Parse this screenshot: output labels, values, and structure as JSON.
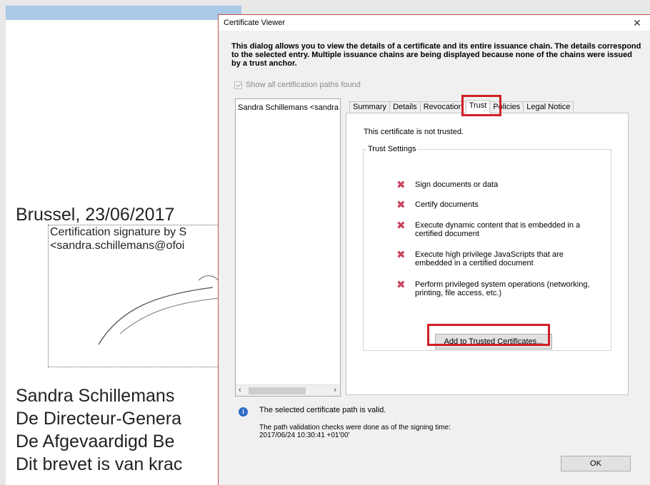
{
  "document": {
    "heading": "Brussel, 23/06/2017",
    "sig_line1": "Certification signature by S",
    "sig_line2": "<sandra.schillemans@ofoi",
    "lines": [
      "Sandra Schillemans",
      "De Directeur-Genera",
      "De Afgevaardigd Be",
      "Dit brevet is van krac"
    ]
  },
  "dialog": {
    "title": "Certificate Viewer",
    "close_glyph": "✕",
    "intro": "This dialog allows you to view the details of a certificate and its entire issuance chain. The details correspond to the selected entry. Multiple issuance chains are being displayed because none of the chains were issued by a trust anchor.",
    "show_all_label": "Show all certification paths found",
    "show_all_checked": true,
    "tree_item": "Sandra Schillemans <sandra.s",
    "scroll_left": "‹",
    "scroll_right": "›",
    "tabs": [
      "Summary",
      "Details",
      "Revocation",
      "Trust",
      "Policies",
      "Legal Notice"
    ],
    "active_tab": "Trust",
    "not_trusted": "This certificate is not trusted.",
    "trust_settings_label": "Trust Settings",
    "trust_items": [
      "Sign documents or data",
      "Certify documents",
      "Execute dynamic content that is embedded in a certified document",
      "Execute high privilege JavaScripts that are embedded in a certified document",
      "Perform privileged system operations (networking, printing, file access, etc.)"
    ],
    "x_glyph": "✖",
    "add_button": "Add to Trusted Certificates...",
    "info_glyph": "i",
    "valid_text": "The selected certificate path is valid.",
    "path_line1": "The path validation checks were done as of the signing time:",
    "path_line2": "2017/06/24 10:30:41 +01'00'",
    "ok_button": "OK"
  },
  "colors": {
    "highlight": "#d01f25",
    "deny_icon": "#c9445e",
    "info_icon": "#2e6cc7"
  }
}
